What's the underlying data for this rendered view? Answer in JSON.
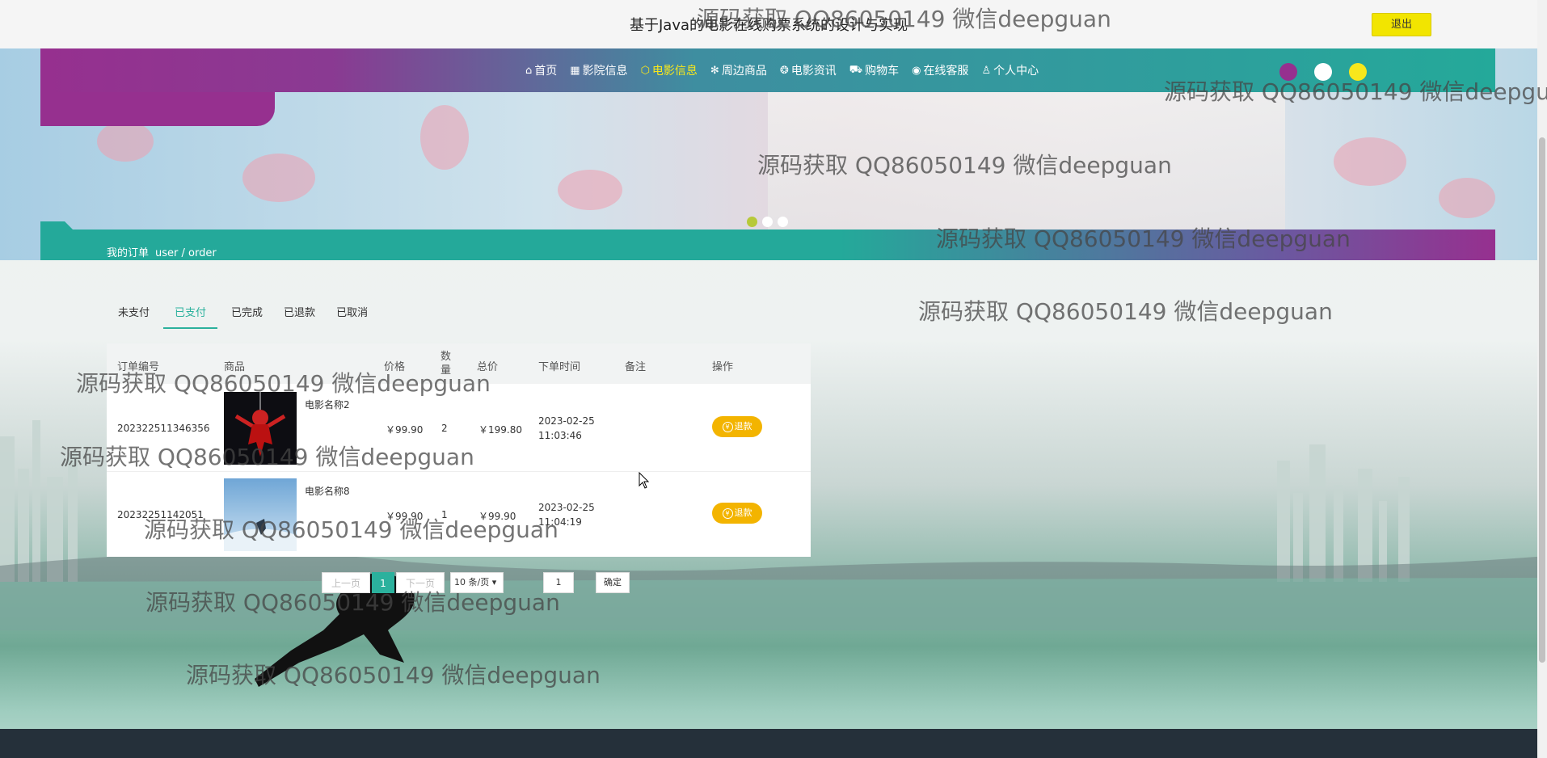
{
  "header": {
    "site_title": "基于Java的电影在线购票系统的设计与实现",
    "logout_label": "退出"
  },
  "nav": {
    "items": [
      {
        "icon": "home-icon",
        "glyph": "⌂",
        "label": "首页",
        "active": false
      },
      {
        "icon": "cinema-icon",
        "glyph": "▦",
        "label": "影院信息",
        "active": false
      },
      {
        "icon": "cube-icon",
        "glyph": "⬡",
        "label": "电影信息",
        "active": true
      },
      {
        "icon": "snowflake-icon",
        "glyph": "✻",
        "label": "周边商品",
        "active": false
      },
      {
        "icon": "palette-icon",
        "glyph": "❂",
        "label": "电影资讯",
        "active": false
      },
      {
        "icon": "cart-icon",
        "glyph": "⛟",
        "label": "购物车",
        "active": false
      },
      {
        "icon": "service-icon",
        "glyph": "◉",
        "label": "在线客服",
        "active": false
      },
      {
        "icon": "user-icon",
        "glyph": "♙",
        "label": "个人中心",
        "active": false
      }
    ],
    "active_color": "#f8e71c",
    "theme_colors": [
      "#96308f",
      "#ffffff",
      "#f8e71c"
    ]
  },
  "breadcrumb": {
    "title": "我的订单",
    "path": "user / order"
  },
  "tabs": [
    {
      "label": "未支付",
      "active": false
    },
    {
      "label": "已支付",
      "active": true
    },
    {
      "label": "已完成",
      "active": false
    },
    {
      "label": "已退款",
      "active": false
    },
    {
      "label": "已取消",
      "active": false
    }
  ],
  "table": {
    "headers": {
      "order_no": "订单编号",
      "goods": "商品",
      "price": "价格",
      "qty": "数量",
      "total": "总价",
      "time": "下单时间",
      "remark": "备注",
      "action": "操作"
    },
    "rows": [
      {
        "order_no": "20232251134635​6",
        "goods_name": "电影名称2",
        "price": "￥99.90",
        "qty": "2",
        "total": "￥199.80",
        "date": "2023-02-25",
        "time": "11:03:46",
        "remark": "",
        "action": "退款"
      },
      {
        "order_no": "20232251142051",
        "goods_name": "电影名称8",
        "price": "￥99.90",
        "qty": "1",
        "total": "￥99.90",
        "date": "2023-02-25",
        "time": "11:04:19",
        "remark": "",
        "action": "退款"
      }
    ]
  },
  "pager": {
    "prev": "上一页",
    "current": "1",
    "next": "下一页",
    "page_size": "10 条/页",
    "goto_value": "1",
    "confirm": "确定"
  },
  "watermark": "源码获取 QQ86050149 微信deepguan",
  "accent_color": "#2bb19d"
}
